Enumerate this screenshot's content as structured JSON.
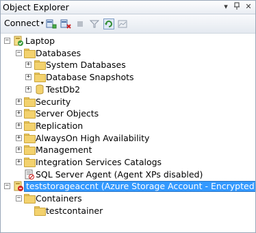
{
  "window": {
    "title": "Object Explorer",
    "controls": {
      "dropdown": "▾",
      "pin": "♮",
      "close": "✕"
    }
  },
  "toolbar": {
    "connect_label": "Connect",
    "connect_caret": "▾",
    "buttons": [
      "connect-object-explorer-icon",
      "disconnect-icon",
      "stop-icon",
      "filter-icon",
      "refresh-icon",
      "activity-monitor-icon"
    ]
  },
  "tree": {
    "server": {
      "label": "Laptop",
      "expander": "−"
    },
    "databases": {
      "label": "Databases",
      "expander": "−"
    },
    "system_databases": {
      "label": "System Databases",
      "expander": "+"
    },
    "database_snapshots": {
      "label": "Database Snapshots",
      "expander": "+"
    },
    "testdb2": {
      "label": "TestDb2",
      "expander": "+"
    },
    "security": {
      "label": "Security",
      "expander": "+"
    },
    "server_objects": {
      "label": "Server Objects",
      "expander": "+"
    },
    "replication": {
      "label": "Replication",
      "expander": "+"
    },
    "alwayson": {
      "label": "AlwaysOn High Availability",
      "expander": "+"
    },
    "management": {
      "label": "Management",
      "expander": "+"
    },
    "integration_services": {
      "label": "Integration Services Catalogs",
      "expander": "+"
    },
    "sql_agent": {
      "label": "SQL Server Agent (Agent XPs disabled)"
    },
    "storage_account": {
      "label": "teststorageaccnt (Azure Storage Account - Encrypted)",
      "expander": "−",
      "selected": true
    },
    "containers": {
      "label": "Containers",
      "expander": "−"
    },
    "testcontainer": {
      "label": "testcontainer"
    }
  },
  "colors": {
    "selection": "#3399ff",
    "folder": "#f3d26e",
    "server_green": "#3a9a3a"
  }
}
